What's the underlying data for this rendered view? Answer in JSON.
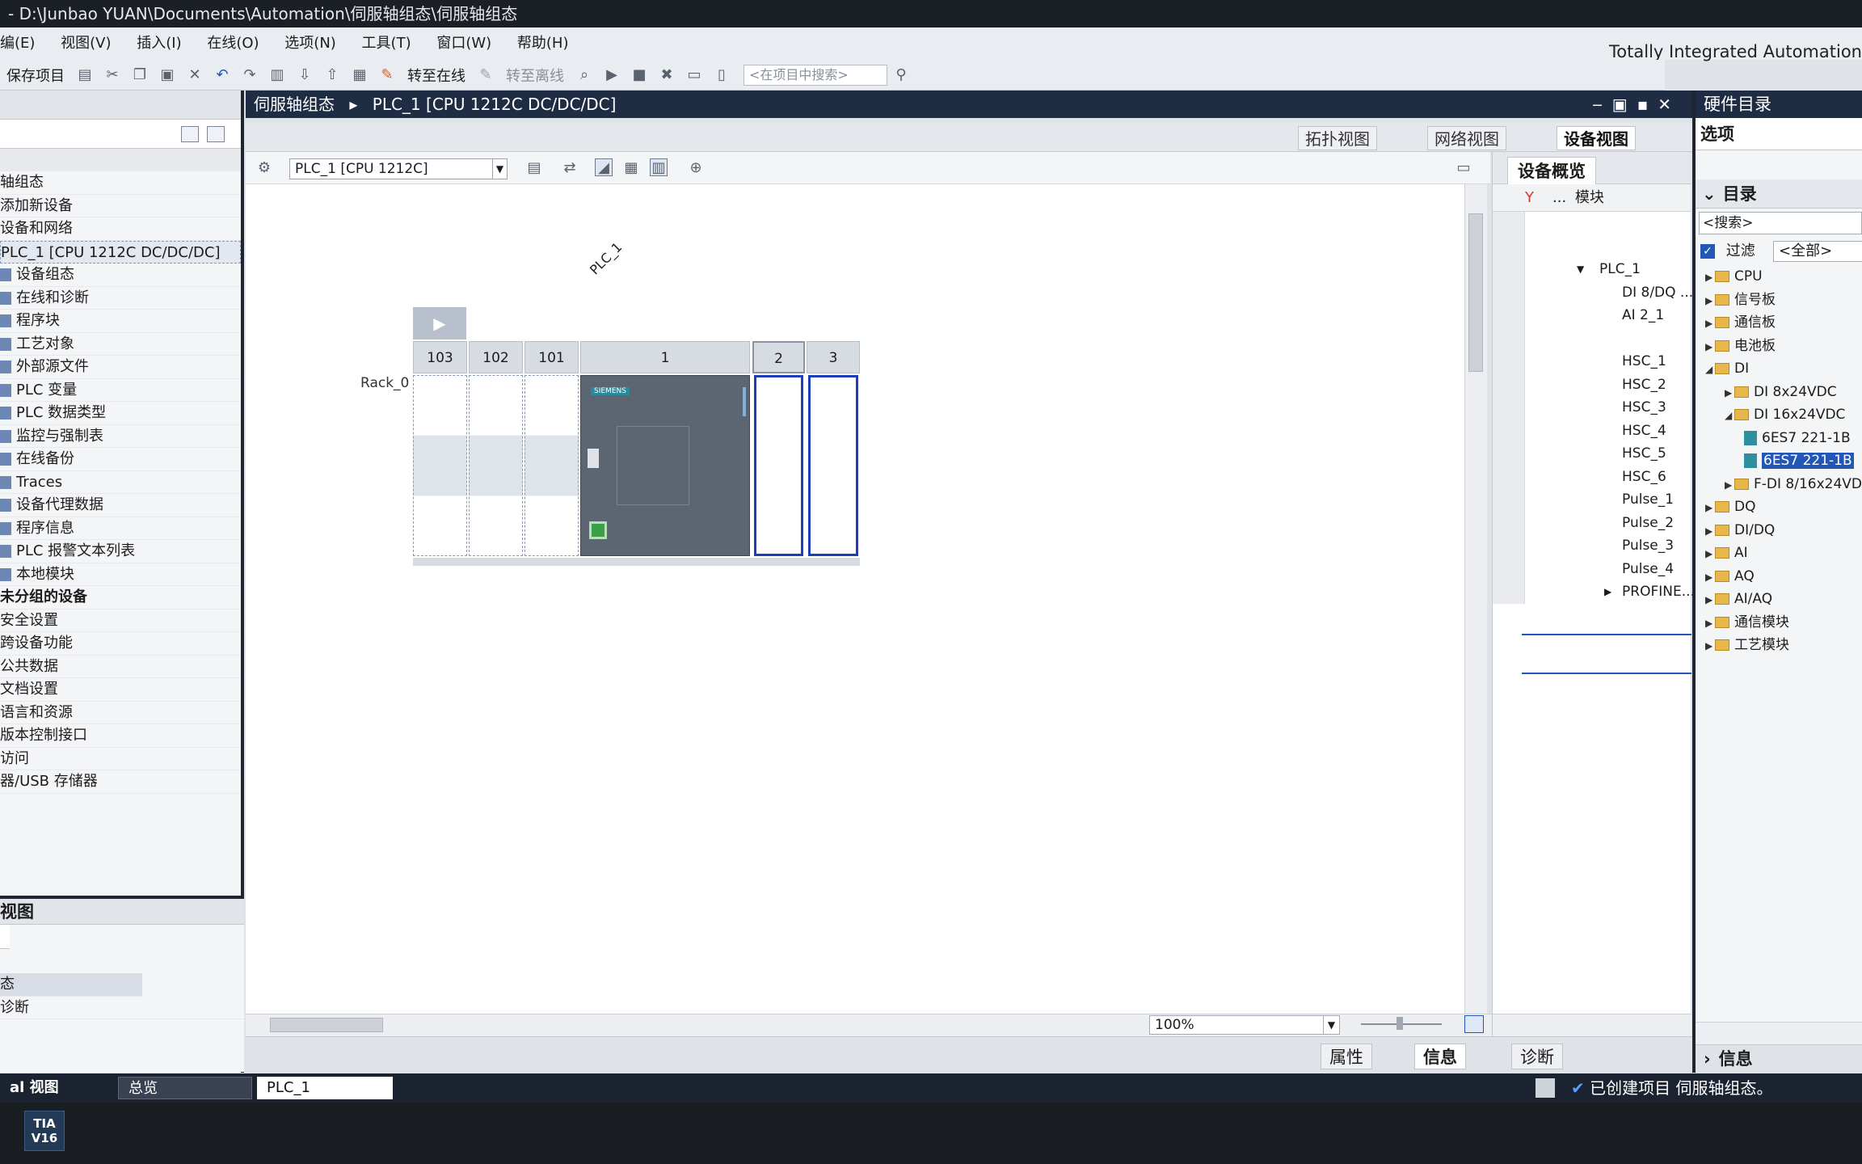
{
  "window": {
    "title": "-  D:\\Junbao YUAN\\Documents\\Automation\\伺服轴组态\\伺服轴组态",
    "brand": "Totally Integrated Automation"
  },
  "menu": [
    "编(E)",
    "视图(V)",
    "插入(I)",
    "在线(O)",
    "选项(N)",
    "工具(T)",
    "窗口(W)",
    "帮助(H)"
  ],
  "toolbar": {
    "save_label": "保存项目",
    "go_online": "转至在线",
    "go_offline": "转至离线",
    "search_placeholder": "<在项目中搜索>"
  },
  "project_tree": {
    "items": [
      {
        "label": "轴组态",
        "bold": false
      },
      {
        "label": "添加新设备",
        "bold": false
      },
      {
        "label": "设备和网络",
        "bold": false
      },
      {
        "label": "PLC_1 [CPU 1212C DC/DC/DC]",
        "bold": false,
        "selected": true
      },
      {
        "label": "设备组态",
        "bold": false
      },
      {
        "label": "在线和诊断",
        "bold": false
      },
      {
        "label": "程序块",
        "bold": false
      },
      {
        "label": "工艺对象",
        "bold": false
      },
      {
        "label": "外部源文件",
        "bold": false
      },
      {
        "label": "PLC 变量",
        "bold": false
      },
      {
        "label": "PLC 数据类型",
        "bold": false
      },
      {
        "label": "监控与强制表",
        "bold": false
      },
      {
        "label": "在线备份",
        "bold": false
      },
      {
        "label": "Traces",
        "bold": false
      },
      {
        "label": "设备代理数据",
        "bold": false
      },
      {
        "label": "程序信息",
        "bold": false
      },
      {
        "label": "PLC 报警文本列表",
        "bold": false
      },
      {
        "label": "本地模块",
        "bold": false
      },
      {
        "label": "未分组的设备",
        "bold": true
      },
      {
        "label": "安全设置",
        "bold": false
      },
      {
        "label": "跨设备功能",
        "bold": false
      },
      {
        "label": "公共数据",
        "bold": false
      },
      {
        "label": "文档设置",
        "bold": false
      },
      {
        "label": "语言和资源",
        "bold": false
      },
      {
        "label": "版本控制接口",
        "bold": false
      },
      {
        "label": "访问",
        "bold": false
      },
      {
        "label": "器/USB 存储器",
        "bold": false
      }
    ]
  },
  "detail_view": {
    "title": "视图",
    "rows": [
      "态",
      "诊断"
    ]
  },
  "editor": {
    "breadcrumb_root": "伺服轴组态",
    "breadcrumb_device": "PLC_1 [CPU 1212C DC/DC/DC]",
    "tabs": [
      "拓扑视图",
      "网络视图",
      "设备视图"
    ],
    "active_tab": "设备视图",
    "device_select": "PLC_1 [CPU 1212C]",
    "plc_tag": "PLC_1",
    "rack_label": "Rack_0",
    "slots": [
      "103",
      "102",
      "101",
      "1",
      "2",
      "3"
    ],
    "cpu_brand": "SIEMENS",
    "zoom": "100%"
  },
  "device_overview": {
    "tab_label": "设备概览",
    "column_module": "模块",
    "column_dots": "...",
    "rows": [
      "",
      "",
      "PLC_1",
      "DI 8/DQ ...",
      "AI 2_1",
      "",
      "HSC_1",
      "HSC_2",
      "HSC_3",
      "HSC_4",
      "HSC_5",
      "HSC_6",
      "Pulse_1",
      "Pulse_2",
      "Pulse_3",
      "Pulse_4",
      "PROFINE..."
    ]
  },
  "catalog": {
    "title": "硬件目录",
    "options_label": "选项",
    "section_label": "目录",
    "search_placeholder": "<搜索>",
    "filter_label": "过滤",
    "filter_value": "<全部>",
    "items": [
      {
        "label": "CPU",
        "level": 0,
        "open": false
      },
      {
        "label": "信号板",
        "level": 0,
        "open": false
      },
      {
        "label": "通信板",
        "level": 0,
        "open": false
      },
      {
        "label": "电池板",
        "level": 0,
        "open": false
      },
      {
        "label": "DI",
        "level": 0,
        "open": true
      },
      {
        "label": "DI 8x24VDC",
        "level": 1,
        "open": false
      },
      {
        "label": "DI 16x24VDC",
        "level": 1,
        "open": true
      },
      {
        "label": "6ES7 221-1B",
        "level": 2,
        "module": true
      },
      {
        "label": "6ES7 221-1B",
        "level": 2,
        "module": true,
        "selected": true
      },
      {
        "label": "F-DI 8/16x24VDC",
        "level": 1,
        "open": false
      },
      {
        "label": "DQ",
        "level": 0,
        "open": false
      },
      {
        "label": "DI/DQ",
        "level": 0,
        "open": false
      },
      {
        "label": "AI",
        "level": 0,
        "open": false
      },
      {
        "label": "AQ",
        "level": 0,
        "open": false
      },
      {
        "label": "AI/AQ",
        "level": 0,
        "open": false
      },
      {
        "label": "通信模块",
        "level": 0,
        "open": false
      },
      {
        "label": "工艺模块",
        "level": 0,
        "open": false
      }
    ],
    "info_label": "信息"
  },
  "inspector_tabs": [
    "属性",
    "信息",
    "诊断"
  ],
  "status": {
    "portal_view": "al 视图",
    "overview_tab": "总览",
    "plc_tab": "PLC_1",
    "message": "已创建项目 伺服轴组态。"
  },
  "taskbar": {
    "app_icon_line1": "TIA",
    "app_icon_line2": "V16"
  },
  "colors": {
    "title_bar": "#1f2d44",
    "selection": "#1a3fb8",
    "cpu_body": "#5b6672",
    "folder": "#e6b84c"
  }
}
